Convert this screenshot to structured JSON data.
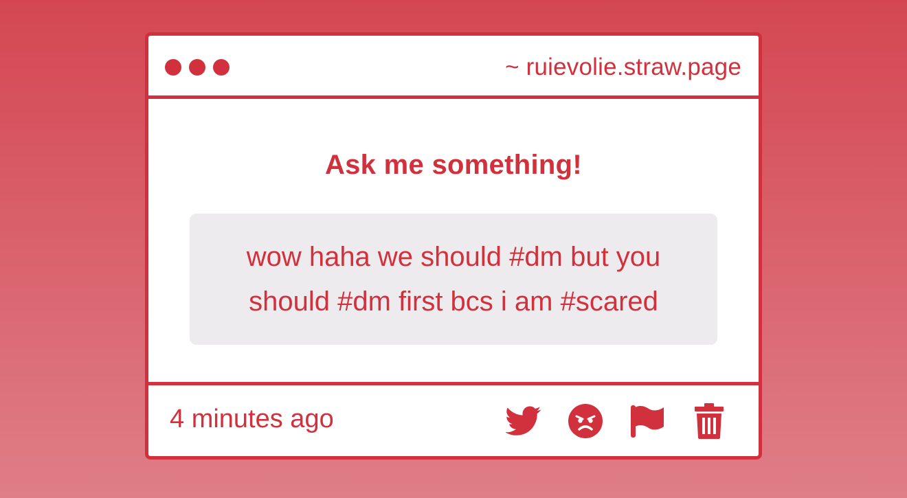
{
  "window": {
    "url": "~ ruievolie.straw.page"
  },
  "main": {
    "prompt": "Ask me something!",
    "message": "wow haha we should #dm but you should #dm first bcs i am #scared"
  },
  "footer": {
    "timestamp": "4 minutes ago",
    "actions": [
      {
        "name": "share-twitter",
        "icon": "twitter-bird-icon"
      },
      {
        "name": "react-angry",
        "icon": "angry-face-icon"
      },
      {
        "name": "report",
        "icon": "flag-icon"
      },
      {
        "name": "delete",
        "icon": "trash-icon"
      }
    ]
  },
  "colors": {
    "accent": "#d1313c",
    "message_background": "#edebed",
    "background_top": "#d44752",
    "background_bottom": "#df7e87"
  }
}
